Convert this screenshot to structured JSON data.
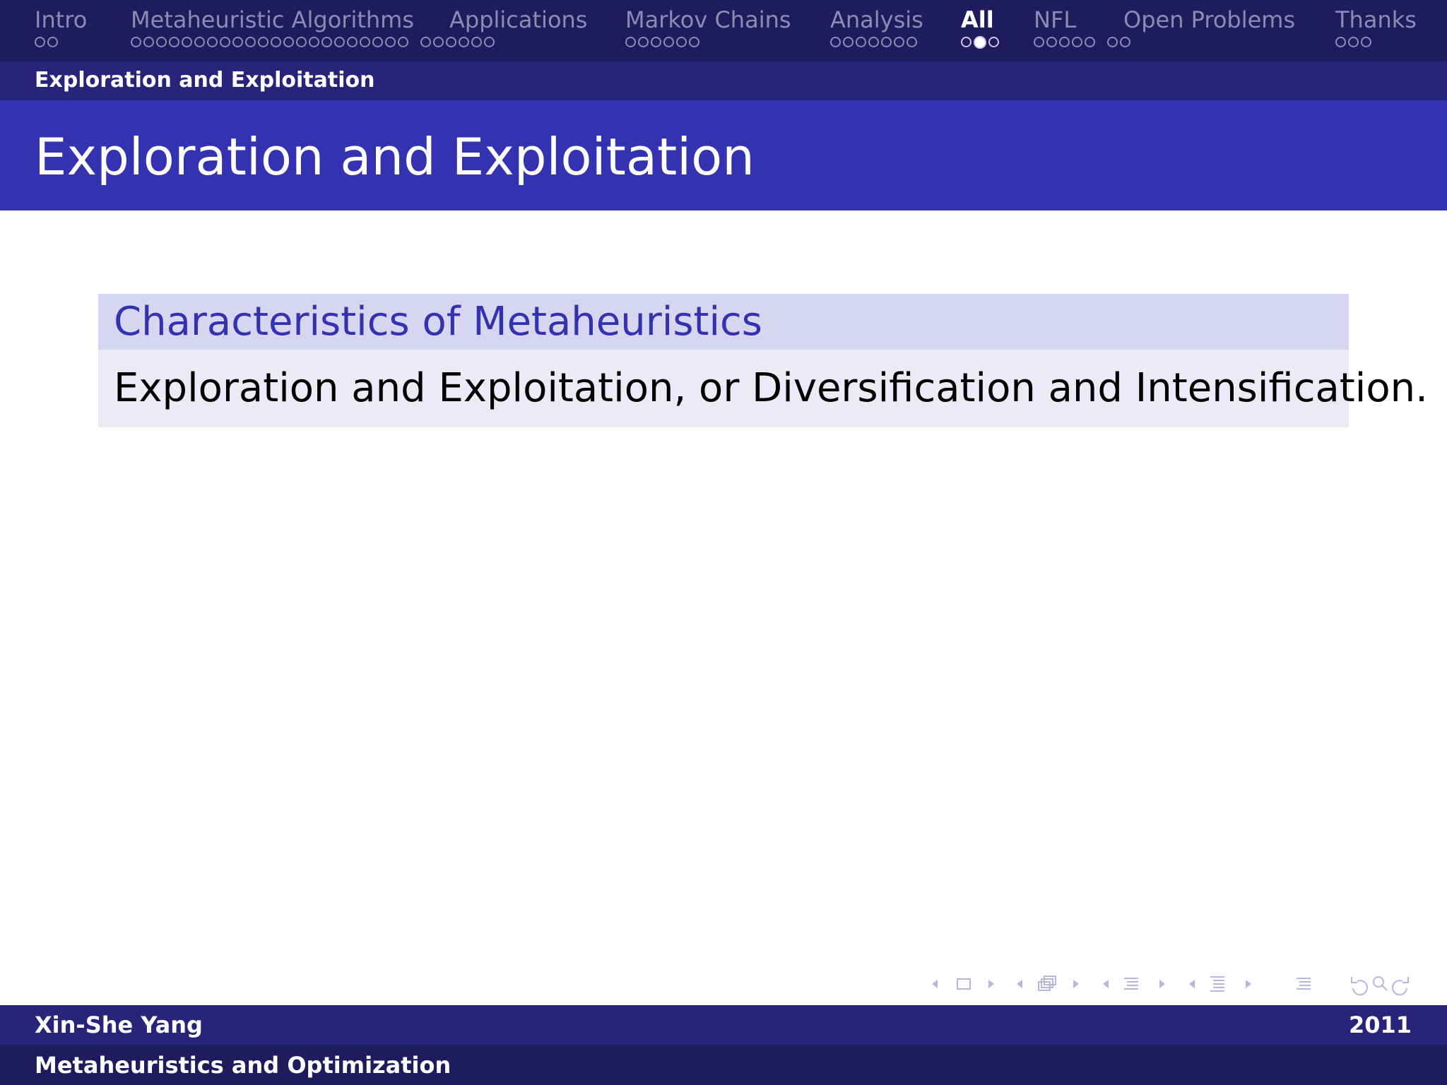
{
  "nav": {
    "sections": [
      {
        "label": "Intro",
        "dot_groups": [
          2
        ],
        "current": -1
      },
      {
        "label": "Metaheuristic Algorithms",
        "dot_groups": [
          22,
          6
        ],
        "current": -1
      },
      {
        "label": "Applications",
        "dot_groups": [],
        "current": -1
      },
      {
        "label": "Markov Chains",
        "dot_groups": [
          6
        ],
        "current": -1
      },
      {
        "label": "Analysis",
        "dot_groups": [
          7
        ],
        "current": -1
      },
      {
        "label": "All",
        "dot_groups": [
          3
        ],
        "current": 1
      },
      {
        "label": "NFL",
        "dot_groups": [
          5,
          2
        ],
        "current": -1
      },
      {
        "label": "Open Problems",
        "dot_groups": [],
        "current": -1
      },
      {
        "label": "Thanks",
        "dot_groups": [
          3
        ],
        "current": -1
      }
    ]
  },
  "subsection": "Exploration and Exploitation",
  "frame_title": "Exploration and Exploitation",
  "block": {
    "title": "Characteristics of Metaheuristics",
    "body": "Exploration and Exploitation, or Diversification and Intensification."
  },
  "footer": {
    "author": "Xin-She Yang",
    "date": "2011",
    "title": "Metaheuristics and Optimization"
  },
  "colors": {
    "nav_bg": "#1f1c5e",
    "subbar_bg": "#27257a",
    "title_bg": "#3333b2",
    "block_title_bg": "#d6d6f0",
    "block_body_bg": "#ebebf7",
    "accent": "#3333b2"
  },
  "beamer_nav_icons": [
    "frame-nav-icon",
    "subsection-nav-icon",
    "section-nav-icon",
    "document-nav-icon",
    "toc-icon",
    "back-icon",
    "search-icon",
    "forward-icon"
  ]
}
